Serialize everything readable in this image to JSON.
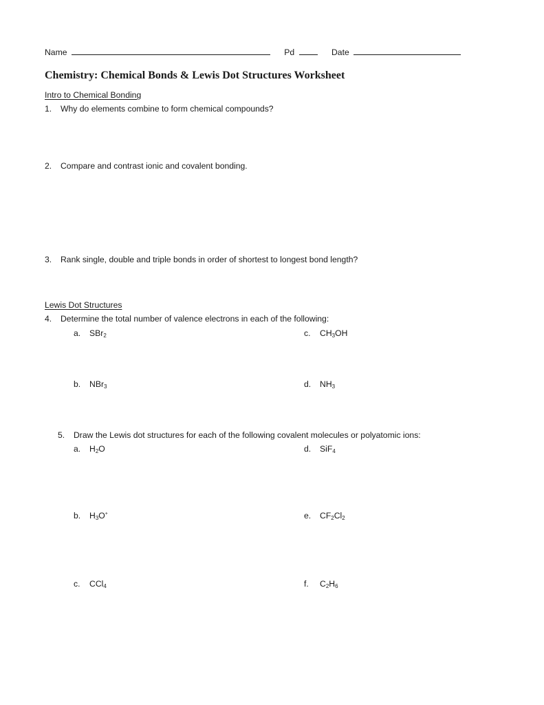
{
  "header": {
    "name_label": "Name",
    "pd_label": "Pd",
    "date_label": "Date"
  },
  "title": "Chemistry: Chemical Bonds & Lewis Dot Structures Worksheet",
  "sections": [
    {
      "heading": "Intro to Chemical Bonding",
      "questions": [
        {
          "number": "1.",
          "text": "Why do elements combine to form chemical compounds?"
        },
        {
          "number": "2.",
          "text": "Compare and contrast ionic and covalent bonding."
        },
        {
          "number": "3.",
          "text": "Rank single, double and triple bonds in order of shortest to longest bond length?"
        }
      ]
    },
    {
      "heading": "Lewis Dot Structures",
      "questions": [
        {
          "number": "4.",
          "text": "Determine the total number of valence electrons in each of the following:",
          "items": [
            {
              "letter": "a.",
              "formula": "SBr₂"
            },
            {
              "letter": "b.",
              "formula": "NBr₃"
            },
            {
              "letter": "c.",
              "formula": "CH₃OH"
            },
            {
              "letter": "d.",
              "formula": "NH₃"
            }
          ]
        },
        {
          "number": "5.",
          "text": "Draw the Lewis dot structures for each of the following covalent molecules or polyatomic ions:",
          "items": [
            {
              "letter": "a.",
              "formula": "H₂O"
            },
            {
              "letter": "b.",
              "formula": "H₃O⁺"
            },
            {
              "letter": "c.",
              "formula": "CCl₄"
            },
            {
              "letter": "d.",
              "formula": "SiF₄"
            },
            {
              "letter": "e.",
              "formula": "CF₂Cl₂"
            },
            {
              "letter": "f.",
              "formula": "C₂H₆"
            }
          ]
        }
      ]
    }
  ]
}
